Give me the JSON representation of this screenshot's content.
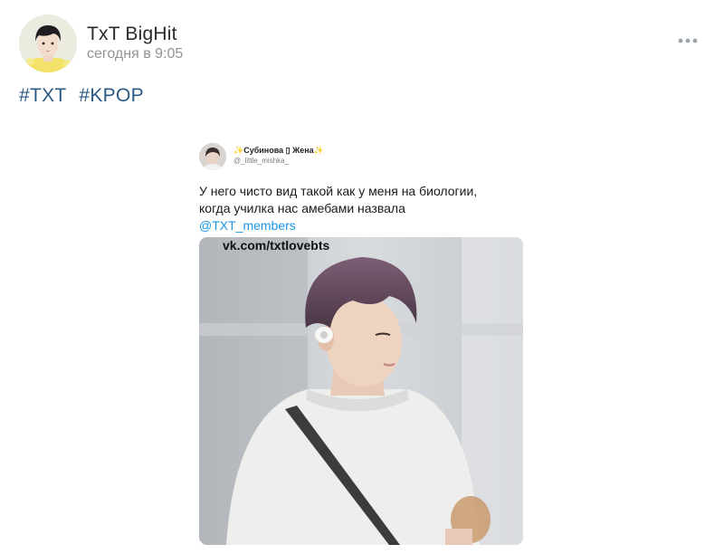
{
  "post": {
    "author": "TxT BigHit",
    "timestamp": "сегодня в 9:05",
    "hashtags": [
      "#TXT",
      "#KPOP"
    ],
    "more_icon": "more-horizontal-icon"
  },
  "tweet": {
    "name": "✨Субинова ▯ Жена✨",
    "handle": "@_little_mishka_",
    "text_lines": [
      "У него чисто вид такой как у меня на биологии,",
      "когда училка нас амебами назвала"
    ],
    "mention": "@TXT_members",
    "photo_watermark": "vk.com/txtlovebts"
  },
  "colors": {
    "link": "#2a5885",
    "mention": "#1b95e0",
    "muted": "#939393",
    "top_strip": "#e6e9ee"
  }
}
